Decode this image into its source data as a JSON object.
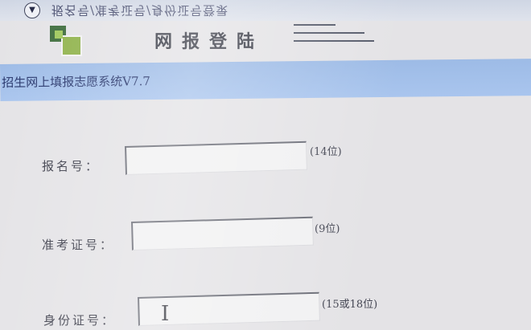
{
  "browser": {
    "title": "报名号/准考证号/身份证号登录",
    "dropdown_icon": "chevron-down-icon"
  },
  "header": {
    "title": "网报登陆",
    "logo_icon": "app-logo-icon"
  },
  "banner": {
    "text": "招生网上填报志愿系统V7.7"
  },
  "form": {
    "fields": [
      {
        "label": "报名号：",
        "hint": "(14位)",
        "value": ""
      },
      {
        "label": "准考证号：",
        "hint": "(9位)",
        "value": ""
      },
      {
        "label": "身份证号：",
        "hint": "(15或18位)",
        "value": ""
      }
    ],
    "text_cursor": "I"
  },
  "colors": {
    "banner": "#a9c5ee",
    "background": "#e4e3e6",
    "logo_dark": "#3c6b3a",
    "logo_light": "#8fb24a"
  }
}
